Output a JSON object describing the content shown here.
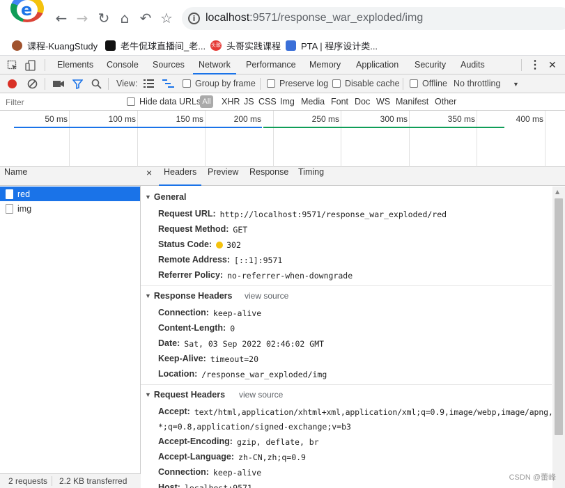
{
  "browser": {
    "logo_letter": "e",
    "back": "←",
    "forward": "→",
    "reload": "↻",
    "home": "⌂",
    "undo": "↶",
    "star": "☆",
    "url_host": "localhost",
    "url_rest": ":9571/response_war_exploded/img",
    "icons": [
      "browser-logo",
      "back-arrow",
      "forward-arrow",
      "reload",
      "home",
      "undo",
      "bookmark-star",
      "site-info"
    ]
  },
  "bookmarks": [
    {
      "label": "课程-KuangStudy",
      "color": "#a0522d"
    },
    {
      "label": "老牛侃球直播间_老...",
      "color": "#111111"
    },
    {
      "label": "头哥实践课程",
      "color": "#e53935",
      "badge": "头歌"
    },
    {
      "label": "PTA | 程序设计类...",
      "color": "#3a6fd8"
    }
  ],
  "devtools": {
    "tabs": [
      "Elements",
      "Console",
      "Sources",
      "Network",
      "Performance",
      "Memory",
      "Application",
      "Security",
      "Audits"
    ],
    "active_tab": "Network",
    "more": "⋮",
    "close": "✕"
  },
  "network_toolbar": {
    "view_label": "View:",
    "group_by_frame": "Group by frame",
    "preserve_log": "Preserve log",
    "disable_cache": "Disable cache",
    "offline": "Offline",
    "throttling": "No throttling"
  },
  "filter_bar": {
    "placeholder": "Filter",
    "hide_data_urls": "Hide data URLs",
    "types": [
      "All",
      "XHR",
      "JS",
      "CSS",
      "Img",
      "Media",
      "Font",
      "Doc",
      "WS",
      "Manifest",
      "Other"
    ]
  },
  "timeline": {
    "ticks": [
      "50 ms",
      "100 ms",
      "150 ms",
      "200 ms",
      "250 ms",
      "300 ms",
      "350 ms",
      "400 ms"
    ],
    "bar_colors": [
      "#1a73e8",
      "#0f9d58"
    ]
  },
  "requests": {
    "column": "Name",
    "items": [
      {
        "name": "red",
        "selected": true
      },
      {
        "name": "img",
        "selected": false
      }
    ],
    "summary_count": "2 requests",
    "summary_transferred": "2.2 KB transferred"
  },
  "details": {
    "close": "×",
    "tabs": [
      "Headers",
      "Preview",
      "Response",
      "Timing"
    ],
    "active_tab": "Headers",
    "general": {
      "title": "General",
      "rows": [
        {
          "key": "Request URL:",
          "value": "http://localhost:9571/response_war_exploded/red"
        },
        {
          "key": "Request Method:",
          "value": "GET"
        },
        {
          "key": "Status Code:",
          "value": "302"
        },
        {
          "key": "Remote Address:",
          "value": "[::1]:9571"
        },
        {
          "key": "Referrer Policy:",
          "value": "no-referrer-when-downgrade"
        }
      ]
    },
    "response_headers": {
      "title": "Response Headers",
      "view_source": "view source",
      "rows": [
        {
          "key": "Connection:",
          "value": "keep-alive"
        },
        {
          "key": "Content-Length:",
          "value": "0"
        },
        {
          "key": "Date:",
          "value": "Sat, 03 Sep 2022 02:46:02 GMT"
        },
        {
          "key": "Keep-Alive:",
          "value": "timeout=20"
        },
        {
          "key": "Location:",
          "value": "/response_war_exploded/img"
        }
      ]
    },
    "request_headers": {
      "title": "Request Headers",
      "view_source": "view source",
      "rows": [
        {
          "key": "Accept:",
          "value": "text/html,application/xhtml+xml,application/xml;q=0.9,image/webp,image/apng,*/"
        },
        {
          "key": "",
          "value": "*;q=0.8,application/signed-exchange;v=b3"
        },
        {
          "key": "Accept-Encoding:",
          "value": "gzip, deflate, br"
        },
        {
          "key": "Accept-Language:",
          "value": "zh-CN,zh;q=0.9"
        },
        {
          "key": "Connection:",
          "value": "keep-alive"
        },
        {
          "key": "Host:",
          "value": "localhost:9571"
        }
      ]
    }
  },
  "watermark": "CSDN @蕾峰"
}
